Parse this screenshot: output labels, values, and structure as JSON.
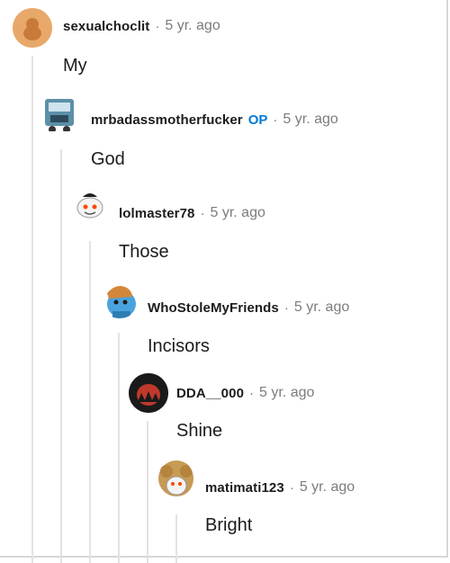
{
  "comments": [
    {
      "username": "sexualchoclit",
      "op_badge": "",
      "separator": "·",
      "time": "5 yr. ago",
      "text": "My",
      "avatar_color": "#e8a86a"
    },
    {
      "username": "mrbadassmotherfucker",
      "op_badge": "OP",
      "separator": "·",
      "time": "5 yr. ago",
      "text": "God",
      "avatar_color": "#5c8fa8"
    },
    {
      "username": "lolmaster78",
      "op_badge": "",
      "separator": "·",
      "time": "5 yr. ago",
      "text": "Those",
      "avatar_color": "#f0f0f0"
    },
    {
      "username": "WhoStoleMyFriends",
      "op_badge": "",
      "separator": "·",
      "time": "5 yr. ago",
      "text": "Incisors",
      "avatar_color": "#4aa3df"
    },
    {
      "username": "DDA__000",
      "op_badge": "",
      "separator": "·",
      "time": "5 yr. ago",
      "text": "Shine",
      "avatar_color": "#1a1a1a"
    },
    {
      "username": "matimati123",
      "op_badge": "",
      "separator": "·",
      "time": "5 yr. ago",
      "text": "Bright",
      "avatar_color": "#c79a55"
    }
  ],
  "colors": {
    "accent_op": "#0079d3",
    "muted": "#7c7c7c",
    "thread_line": "#e3e3e3"
  }
}
